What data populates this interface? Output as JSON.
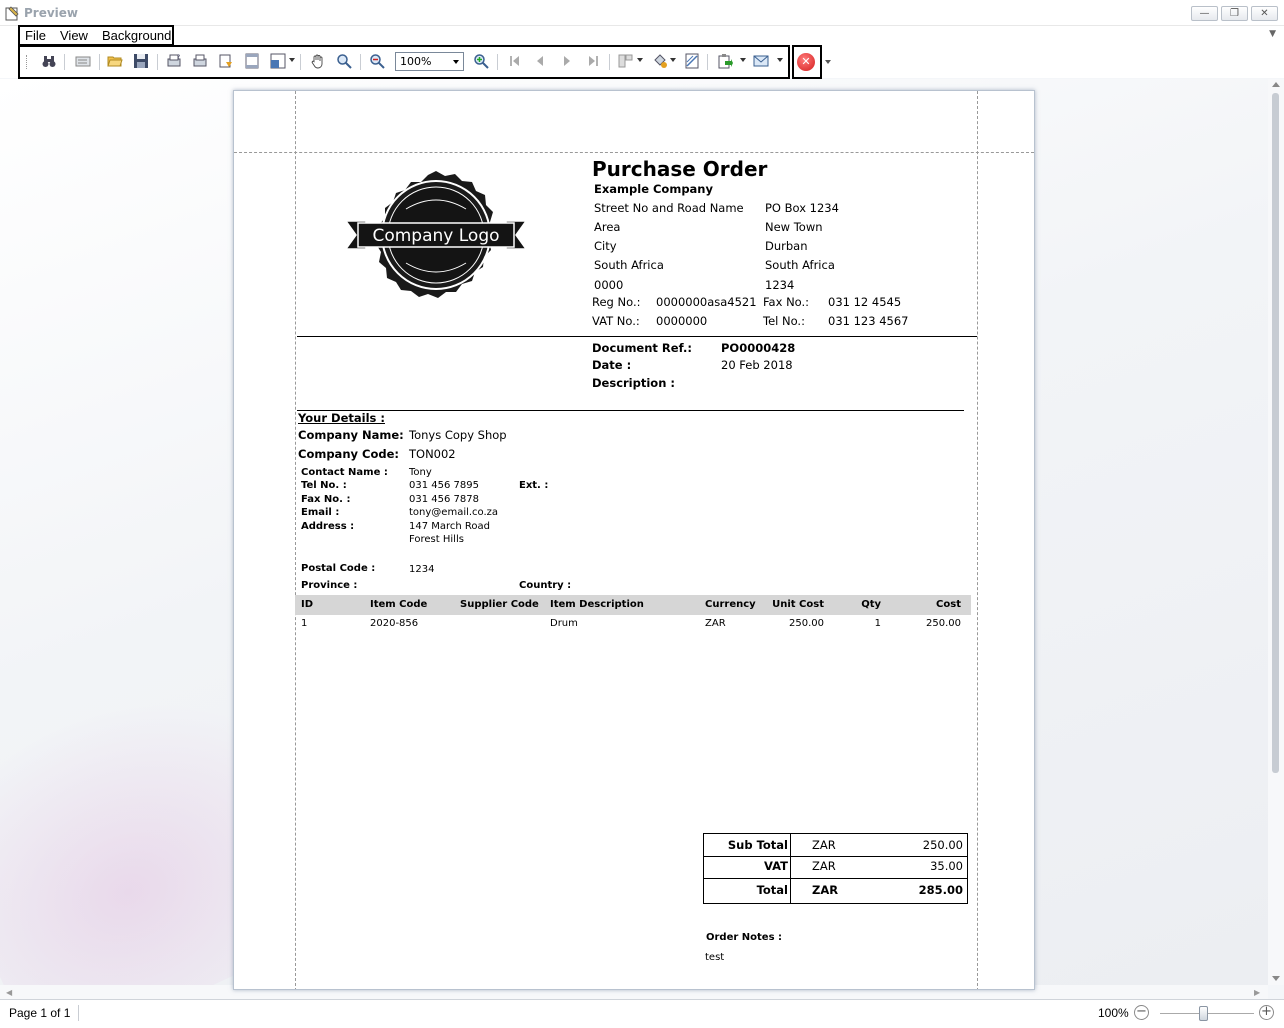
{
  "window": {
    "title": "Preview"
  },
  "menu": {
    "file": "File",
    "view": "View",
    "background": "Background"
  },
  "toolbar": {
    "zoom_value": "100%",
    "icons": [
      "binoculars-icon",
      "parameters-icon",
      "open-icon",
      "save-icon",
      "page-setup-icon",
      "print-icon",
      "quick-print-icon",
      "header-footer-icon",
      "scale-icon",
      "hand-tool-icon",
      "magnifier-icon",
      "zoom-out-icon",
      "zoom-in-icon",
      "first-page-icon",
      "previous-page-icon",
      "next-page-icon",
      "last-page-icon",
      "multiple-pages-icon",
      "fill-background-icon",
      "watermark-icon",
      "export-icon",
      "send-email-icon",
      "close-preview-icon"
    ]
  },
  "document": {
    "title": "Purchase Order",
    "company": {
      "name": "Example Company",
      "logo_text": "Company Logo",
      "street": "Street No and Road Name",
      "area": "Area",
      "city": "City",
      "country": "South Africa",
      "code": "0000",
      "postal_box": "PO Box 1234",
      "postal_town": "New Town",
      "postal_city": "Durban",
      "postal_country": "South Africa",
      "postal_code": "1234",
      "reg_label": "Reg No.:",
      "reg_value": "0000000asa4521",
      "fax_label": "Fax No.:",
      "fax_value": "031 12 4545",
      "vat_label": "VAT No.:",
      "vat_value": "0000000",
      "tel_label": "Tel No.:",
      "tel_value": "031 123 4567"
    },
    "meta": {
      "docref_label": "Document Ref.:",
      "docref_value": "PO0000428",
      "date_label": "Date :",
      "date_value": "20 Feb 2018",
      "description_label": "Description :"
    },
    "details": {
      "heading": "Your Details :",
      "company_name_label": "Company Name:",
      "company_name_value": "Tonys Copy Shop",
      "company_code_label": "Company Code:",
      "company_code_value": "TON002",
      "contact_label": "Contact Name :",
      "contact_value": "Tony",
      "tel_label": "Tel No. :",
      "tel_value": "031 456 7895",
      "ext_label": "Ext. :",
      "fax_label": "Fax No. :",
      "fax_value": "031 456 7878",
      "email_label": "Email :",
      "email_value": "tony@email.co.za",
      "address_label": "Address :",
      "address_line1": "147 March Road",
      "address_line2": "Forest Hills",
      "postal_label": "Postal Code :",
      "postal_value": "1234",
      "province_label": "Province :",
      "country_label": "Country :"
    },
    "items": {
      "headers": [
        "ID",
        "Item Code",
        "Supplier Code",
        "Item Description",
        "Currency",
        "Unit Cost",
        "Qty",
        "Cost"
      ],
      "rows": [
        [
          "1",
          "2020-856",
          "",
          "Drum",
          "ZAR",
          "250.00",
          "1",
          "250.00"
        ]
      ]
    },
    "totals": {
      "subtotal_label": "Sub Total",
      "subtotal_currency": "ZAR",
      "subtotal_value": "250.00",
      "vat_label": "VAT",
      "vat_currency": "ZAR",
      "vat_value": "35.00",
      "total_label": "Total",
      "total_currency": "ZAR",
      "total_value": "285.00"
    },
    "notes": {
      "label": "Order Notes :",
      "value": "test"
    }
  },
  "status": {
    "page": "Page 1 of 1",
    "zoom": "100%"
  }
}
